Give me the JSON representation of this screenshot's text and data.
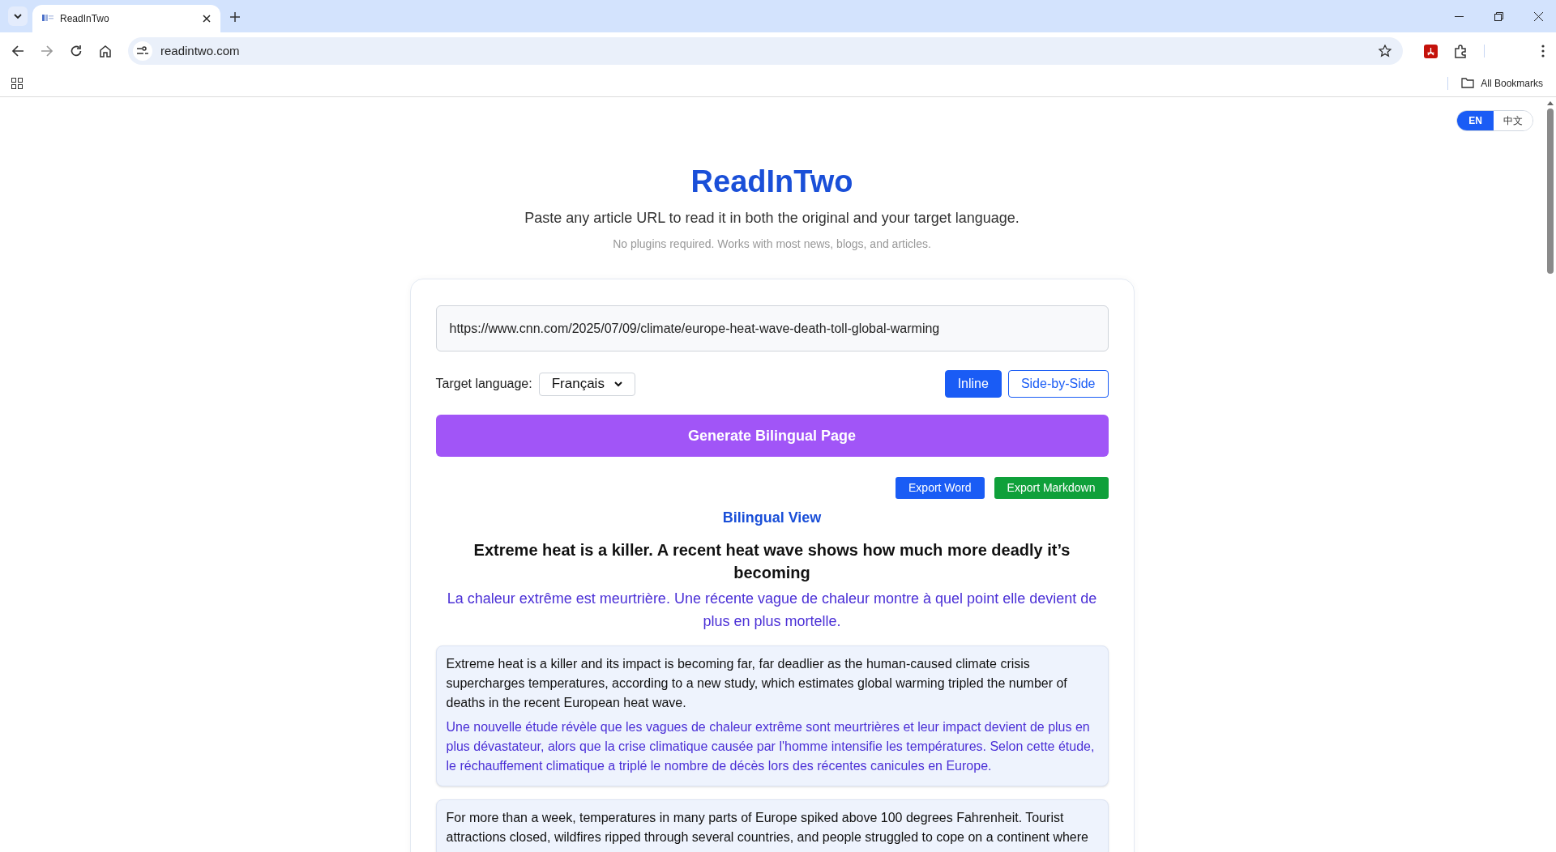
{
  "browser": {
    "tab": {
      "title": "ReadInTwo"
    },
    "address": "readintwo.com",
    "bookmarks_label": "All Bookmarks"
  },
  "language_switch": [
    {
      "label": "EN",
      "selected": true
    },
    {
      "label": "中文",
      "selected": false
    }
  ],
  "header": {
    "title": "ReadInTwo",
    "subtitle": "Paste any article URL to read it in both the original and your target language.",
    "note": "No plugins required. Works with most news, blogs, and articles."
  },
  "form": {
    "url": "https://www.cnn.com/2025/07/09/climate/europe-heat-wave-death-toll-global-warming",
    "target_label": "Target language:",
    "target_value": "Français",
    "view_modes": [
      {
        "label": "Inline",
        "selected": true
      },
      {
        "label": "Side-by-Side",
        "selected": false
      }
    ],
    "generate_button": "Generate Bilingual Page"
  },
  "export_buttons": [
    {
      "label": "Export Word",
      "kind": "word"
    },
    {
      "label": "Export Markdown",
      "kind": "markdown"
    }
  ],
  "bilingual_view": {
    "heading": "Bilingual View",
    "title_original": "Extreme heat is a killer. A recent heat wave shows how much more deadly it’s becoming",
    "title_translated": "La chaleur extrême est meurtrière. Une récente vague de chaleur montre à quel point elle devient de plus en plus mortelle.",
    "paragraphs": [
      {
        "original": "Extreme heat is a killer and its impact is becoming far, far deadlier as the human-caused climate crisis supercharges temperatures, according to a new study, which estimates global warming tripled the number of deaths in the recent European heat wave.",
        "translated": "Une nouvelle étude révèle que les vagues de chaleur extrême sont meurtrières et leur impact devient de plus en plus dévastateur, alors que la crise climatique causée par l'homme intensifie les températures. Selon cette étude, le réchauffement climatique a triplé le nombre de décès lors des récentes canicules en Europe."
      },
      {
        "original": "For more than a week, temperatures in many parts of Europe spiked above 100 degrees Fahrenheit. Tourist attractions closed, wildfires ripped through several countries, and people struggled to cope on a continent where"
      }
    ]
  }
}
